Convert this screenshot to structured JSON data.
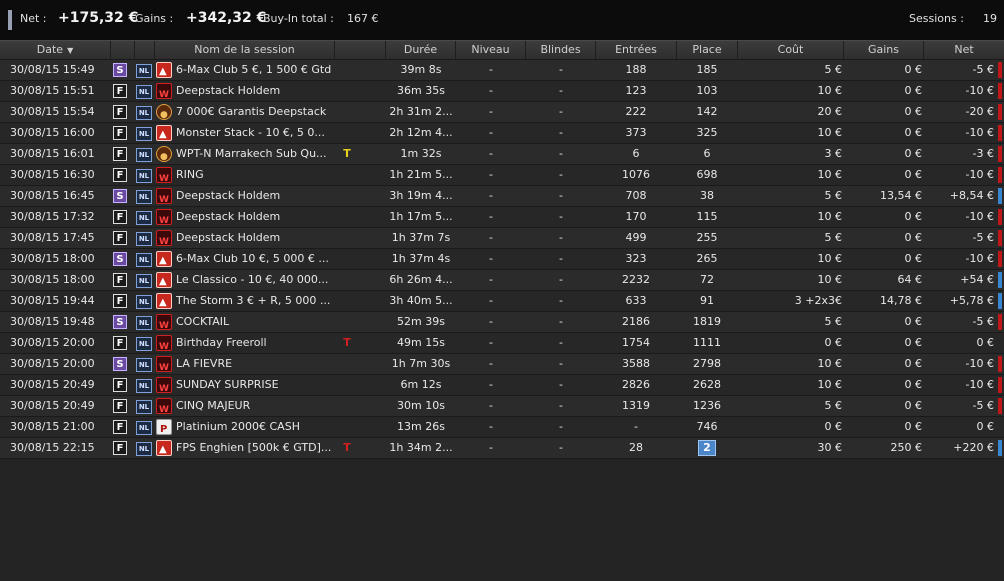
{
  "summary": {
    "net_label": "Net :",
    "net_value": "+175,32 €",
    "gains_label": "Gains :",
    "gains_value": "+342,32 €",
    "buyin_label": "Buy-In total :",
    "buyin_value": "167 €",
    "sessions_label": "Sessions :",
    "sessions_value": "19"
  },
  "columns": {
    "date": "Date",
    "name": "Nom de la session",
    "duration": "Durée",
    "level": "Niveau",
    "blinds": "Blindes",
    "entries": "Entrées",
    "place": "Place",
    "cost": "Coût",
    "gains": "Gains",
    "net": "Net"
  },
  "colors": {
    "negative_bar": "#c01818",
    "positive_bar": "#3a86d0",
    "highlight_place": "#4a86c8"
  },
  "rows": [
    {
      "date": "30/08/15 15:49",
      "badge": "S",
      "nl": "NL",
      "room": "pokerstars",
      "name": "6-Max Club 5 €, 1 500 € Gtd",
      "flag": "",
      "duration": "39m 8s",
      "level": "-",
      "blinds": "-",
      "entries": "188",
      "place": "185",
      "place_highlight": false,
      "cost": "5 €",
      "gains": "0 €",
      "net": "-5 €",
      "sign": "neg"
    },
    {
      "date": "30/08/15 15:51",
      "badge": "F",
      "nl": "NL",
      "room": "winamax",
      "name": "Deepstack Holdem",
      "flag": "",
      "duration": "36m 35s",
      "level": "-",
      "blinds": "-",
      "entries": "123",
      "place": "103",
      "place_highlight": false,
      "cost": "10 €",
      "gains": "0 €",
      "net": "-10 €",
      "sign": "neg"
    },
    {
      "date": "30/08/15 15:54",
      "badge": "F",
      "nl": "NL",
      "room": "partouche",
      "name": "7 000€ Garantis Deepstack",
      "flag": "",
      "duration": "2h 31m 2...",
      "level": "-",
      "blinds": "-",
      "entries": "222",
      "place": "142",
      "place_highlight": false,
      "cost": "20 €",
      "gains": "0 €",
      "net": "-20 €",
      "sign": "neg"
    },
    {
      "date": "30/08/15 16:00",
      "badge": "F",
      "nl": "NL",
      "room": "pokerstars",
      "name": "Monster Stack - 10 €, 5 0...",
      "flag": "",
      "duration": "2h 12m 4...",
      "level": "-",
      "blinds": "-",
      "entries": "373",
      "place": "325",
      "place_highlight": false,
      "cost": "10 €",
      "gains": "0 €",
      "net": "-10 €",
      "sign": "neg"
    },
    {
      "date": "30/08/15 16:01",
      "badge": "F",
      "nl": "NL",
      "room": "partouche",
      "name": "WPT-N Marrakech Sub Qu...",
      "flag": "T",
      "flag_color": "yellow",
      "duration": "1m 32s",
      "level": "-",
      "blinds": "-",
      "entries": "6",
      "place": "6",
      "place_highlight": false,
      "cost": "3 €",
      "gains": "0 €",
      "net": "-3 €",
      "sign": "neg"
    },
    {
      "date": "30/08/15 16:30",
      "badge": "F",
      "nl": "NL",
      "room": "winamax",
      "name": "RING",
      "flag": "",
      "duration": "1h 21m 5...",
      "level": "-",
      "blinds": "-",
      "entries": "1076",
      "place": "698",
      "place_highlight": false,
      "cost": "10 €",
      "gains": "0 €",
      "net": "-10 €",
      "sign": "neg"
    },
    {
      "date": "30/08/15 16:45",
      "badge": "S",
      "nl": "NL",
      "room": "winamax",
      "name": "Deepstack Holdem",
      "flag": "",
      "duration": "3h 19m 4...",
      "level": "-",
      "blinds": "-",
      "entries": "708",
      "place": "38",
      "place_highlight": false,
      "cost": "5 €",
      "gains": "13,54 €",
      "net": "+8,54 €",
      "sign": "pos"
    },
    {
      "date": "30/08/15 17:32",
      "badge": "F",
      "nl": "NL",
      "room": "winamax",
      "name": "Deepstack Holdem",
      "flag": "",
      "duration": "1h 17m 5...",
      "level": "-",
      "blinds": "-",
      "entries": "170",
      "place": "115",
      "place_highlight": false,
      "cost": "10 €",
      "gains": "0 €",
      "net": "-10 €",
      "sign": "neg"
    },
    {
      "date": "30/08/15 17:45",
      "badge": "F",
      "nl": "NL",
      "room": "winamax",
      "name": "Deepstack Holdem",
      "flag": "",
      "duration": "1h 37m 7s",
      "level": "-",
      "blinds": "-",
      "entries": "499",
      "place": "255",
      "place_highlight": false,
      "cost": "5 €",
      "gains": "0 €",
      "net": "-5 €",
      "sign": "neg"
    },
    {
      "date": "30/08/15 18:00",
      "badge": "S",
      "nl": "NL",
      "room": "pokerstars",
      "name": "6-Max Club 10 €, 5 000 € ...",
      "flag": "",
      "duration": "1h 37m 4s",
      "level": "-",
      "blinds": "-",
      "entries": "323",
      "place": "265",
      "place_highlight": false,
      "cost": "10 €",
      "gains": "0 €",
      "net": "-10 €",
      "sign": "neg"
    },
    {
      "date": "30/08/15 18:00",
      "badge": "F",
      "nl": "NL",
      "room": "pokerstars",
      "name": "Le Classico - 10 €, 40 000...",
      "flag": "",
      "duration": "6h 26m 4...",
      "level": "-",
      "blinds": "-",
      "entries": "2232",
      "place": "72",
      "place_highlight": false,
      "cost": "10 €",
      "gains": "64 €",
      "net": "+54 €",
      "sign": "pos"
    },
    {
      "date": "30/08/15 19:44",
      "badge": "F",
      "nl": "NL",
      "room": "pokerstars",
      "name": "The Storm 3 € + R, 5 000 ...",
      "flag": "",
      "duration": "3h 40m 5...",
      "level": "-",
      "blinds": "-",
      "entries": "633",
      "place": "91",
      "place_highlight": false,
      "cost": "3  +2x3€",
      "gains": "14,78 €",
      "net": "+5,78 €",
      "sign": "pos"
    },
    {
      "date": "30/08/15 19:48",
      "badge": "S",
      "nl": "NL",
      "room": "winamax",
      "name": "COCKTAIL",
      "flag": "",
      "duration": "52m 39s",
      "level": "-",
      "blinds": "-",
      "entries": "2186",
      "place": "1819",
      "place_highlight": false,
      "cost": "5 €",
      "gains": "0 €",
      "net": "-5 €",
      "sign": "neg"
    },
    {
      "date": "30/08/15 20:00",
      "badge": "F",
      "nl": "NL",
      "room": "winamax",
      "name": "Birthday Freeroll",
      "flag": "T",
      "flag_color": "red",
      "duration": "49m 15s",
      "level": "-",
      "blinds": "-",
      "entries": "1754",
      "place": "1111",
      "place_highlight": false,
      "cost": "0 €",
      "gains": "0 €",
      "net": "0 €",
      "sign": "zero"
    },
    {
      "date": "30/08/15 20:00",
      "badge": "S",
      "nl": "NL",
      "room": "winamax",
      "name": "LA FIEVRE",
      "flag": "",
      "duration": "1h 7m 30s",
      "level": "-",
      "blinds": "-",
      "entries": "3588",
      "place": "2798",
      "place_highlight": false,
      "cost": "10 €",
      "gains": "0 €",
      "net": "-10 €",
      "sign": "neg"
    },
    {
      "date": "30/08/15 20:49",
      "badge": "F",
      "nl": "NL",
      "room": "winamax",
      "name": "SUNDAY SURPRISE",
      "flag": "",
      "duration": "6m 12s",
      "level": "-",
      "blinds": "-",
      "entries": "2826",
      "place": "2628",
      "place_highlight": false,
      "cost": "10 €",
      "gains": "0 €",
      "net": "-10 €",
      "sign": "neg"
    },
    {
      "date": "30/08/15 20:49",
      "badge": "F",
      "nl": "NL",
      "room": "winamax",
      "name": "CINQ MAJEUR",
      "flag": "",
      "duration": "30m 10s",
      "level": "-",
      "blinds": "-",
      "entries": "1319",
      "place": "1236",
      "place_highlight": false,
      "cost": "5 €",
      "gains": "0 €",
      "net": "-5 €",
      "sign": "neg"
    },
    {
      "date": "30/08/15 21:00",
      "badge": "F",
      "nl": "NL",
      "room": "cash",
      "name": "Platinium 2000€ CASH",
      "flag": "",
      "duration": "13m 26s",
      "level": "-",
      "blinds": "-",
      "entries": "-",
      "place": "746",
      "place_highlight": false,
      "cost": "0 €",
      "gains": "0 €",
      "net": "0 €",
      "sign": "zero"
    },
    {
      "date": "30/08/15 22:15",
      "badge": "F",
      "nl": "NL",
      "room": "pokerstars",
      "name": "FPS Enghien [500k € GTD]...",
      "flag": "T",
      "flag_color": "red",
      "duration": "1h 34m 2...",
      "level": "-",
      "blinds": "-",
      "entries": "28",
      "place": "2",
      "place_highlight": true,
      "cost": "30 €",
      "gains": "250 €",
      "net": "+220 €",
      "sign": "pos"
    }
  ]
}
